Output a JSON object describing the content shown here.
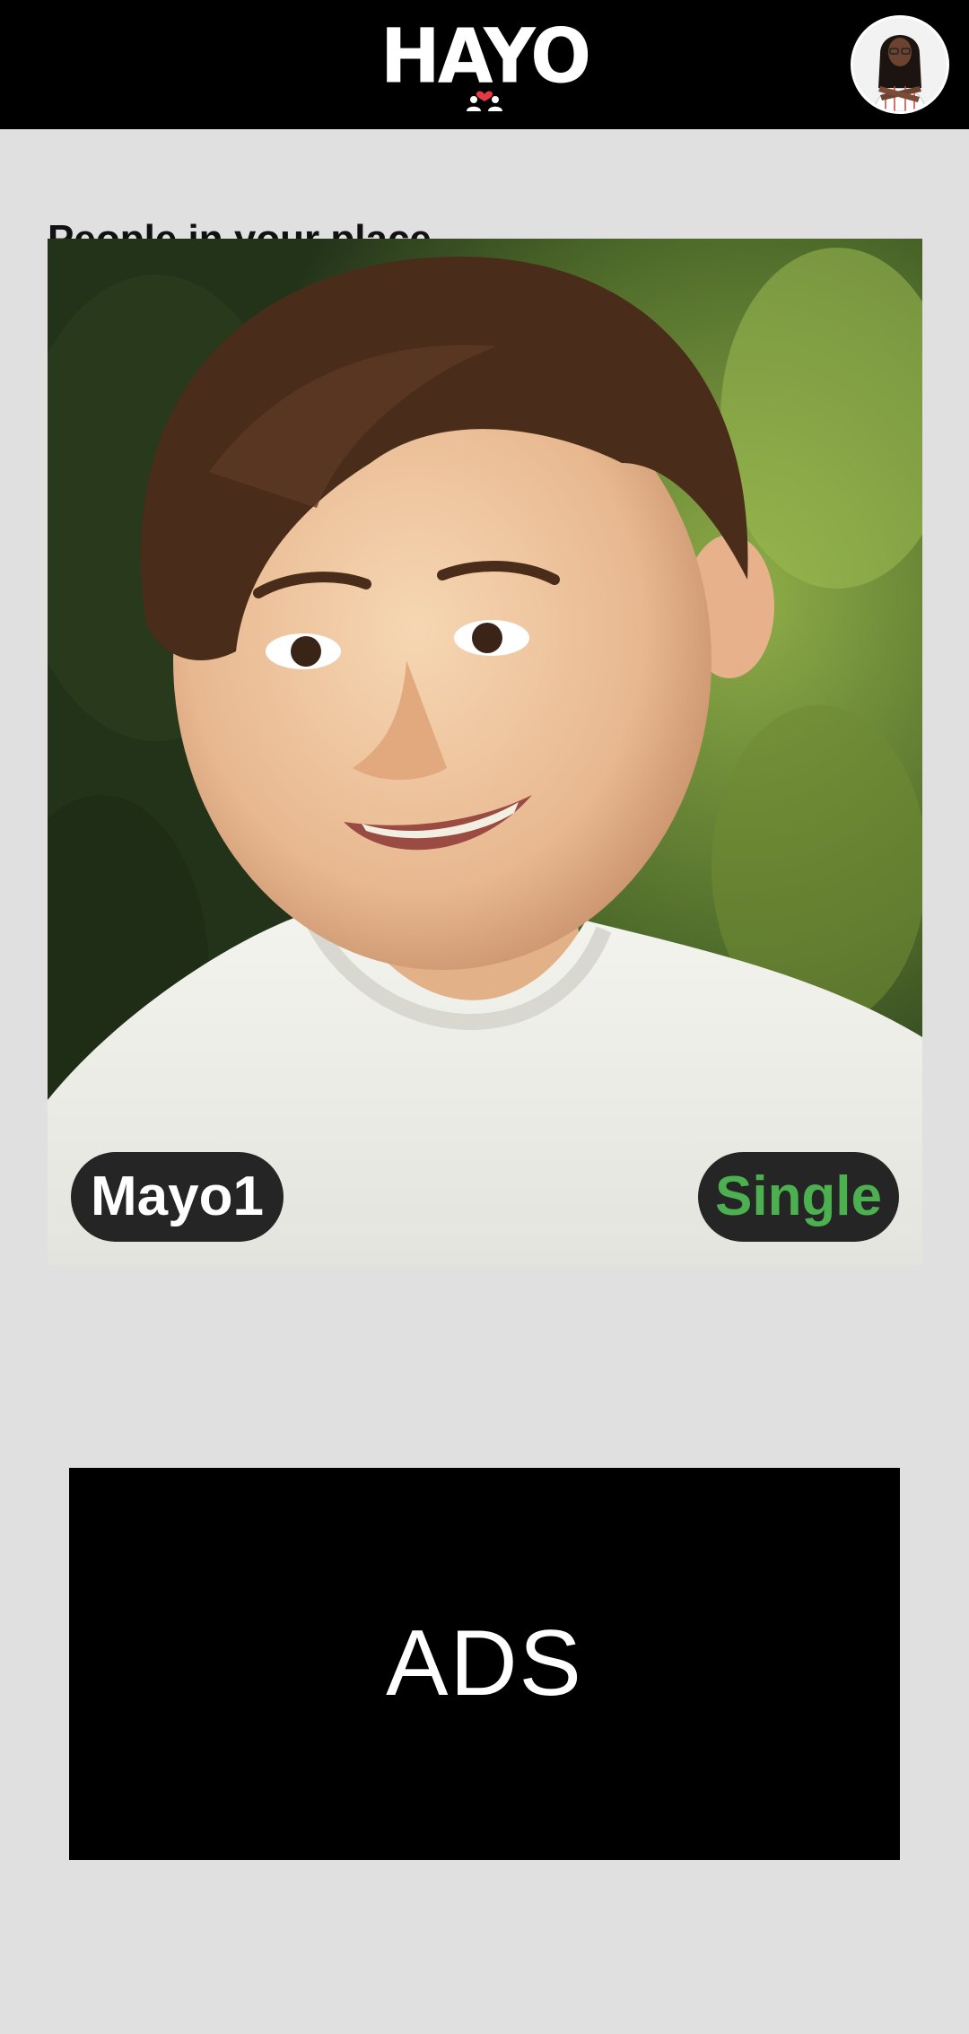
{
  "header": {
    "logo_text": "HAYO",
    "logo_icon": "two-people-heart-icon",
    "avatar_icon": "user-avatar-icon"
  },
  "main": {
    "section_title": "People in your place",
    "profile": {
      "name": "Mayo1",
      "status": "Single",
      "status_color": "#4caf50"
    }
  },
  "ads": {
    "label": "ADS"
  },
  "colors": {
    "background": "#e0e0e0",
    "header": "#000000",
    "pill": "#252525",
    "accent_green": "#4caf50"
  }
}
